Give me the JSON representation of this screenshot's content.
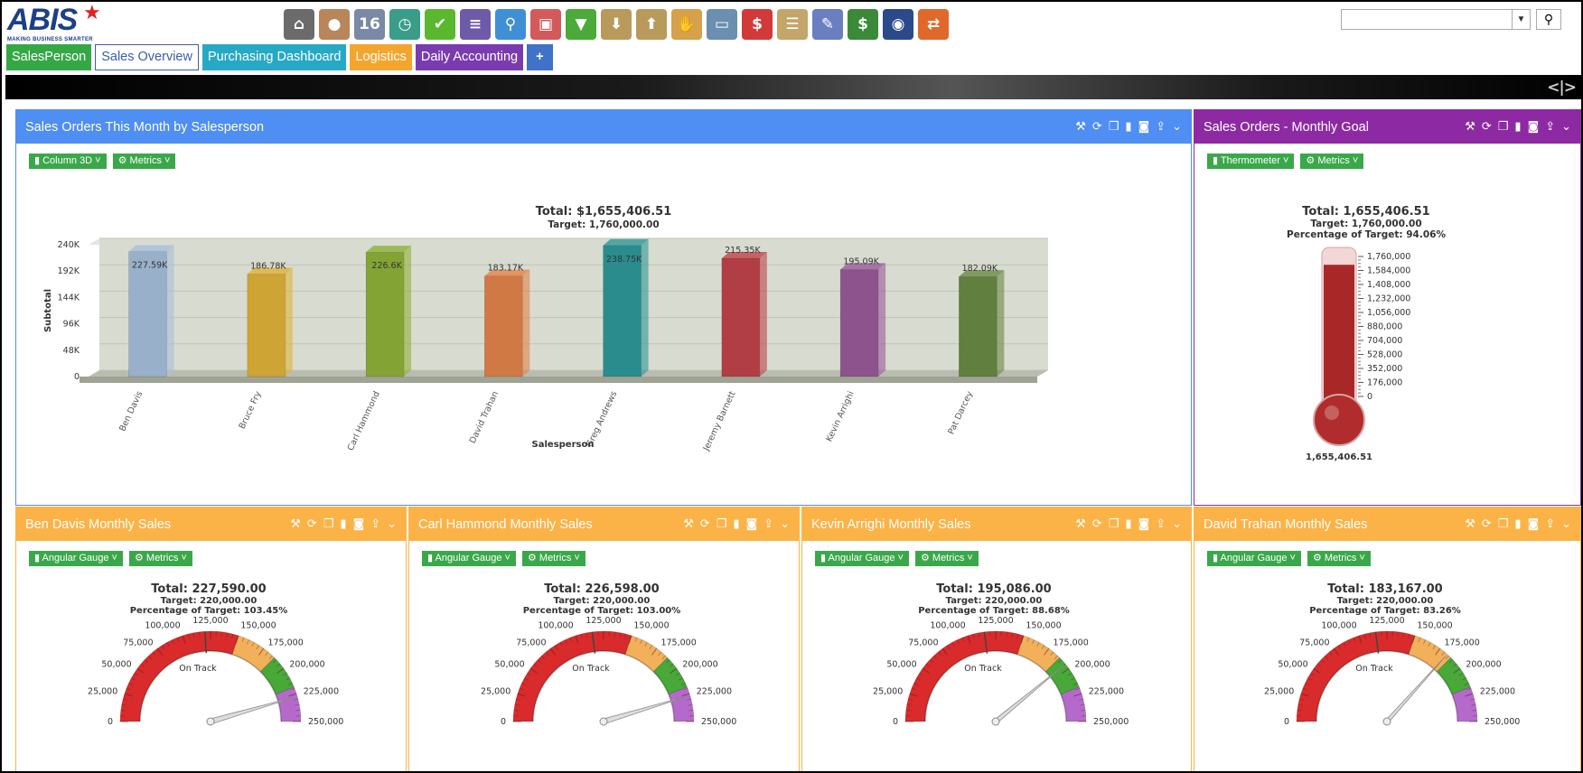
{
  "logo": {
    "text": "ABIS",
    "tagline": "MAKING BUSINESS SMARTER"
  },
  "toolbar": [
    {
      "icon": "bank-icon",
      "color": "#6b6b6b",
      "glyph": "⌂"
    },
    {
      "icon": "user-icon",
      "color": "#b8865a",
      "glyph": "●"
    },
    {
      "icon": "calendar-icon",
      "color": "#7a8aa6",
      "glyph": "16"
    },
    {
      "icon": "clock-icon",
      "color": "#3a9d8a",
      "glyph": "◷"
    },
    {
      "icon": "checkmark-icon",
      "color": "#5ab82f",
      "glyph": "✔"
    },
    {
      "icon": "register-icon",
      "color": "#6d5aa8",
      "glyph": "≡"
    },
    {
      "icon": "magnifier-icon",
      "color": "#3f8fd6",
      "glyph": "⚲"
    },
    {
      "icon": "truck-icon",
      "color": "#d25a5a",
      "glyph": "▣"
    },
    {
      "icon": "basket-icon",
      "color": "#4caa3a",
      "glyph": "▼"
    },
    {
      "icon": "inbox-download-icon",
      "color": "#b89a5a",
      "glyph": "⬇"
    },
    {
      "icon": "outbox-upload-icon",
      "color": "#b89a5a",
      "glyph": "⬆"
    },
    {
      "icon": "hand-coins-icon",
      "color": "#d7a04a",
      "glyph": "✋"
    },
    {
      "icon": "monitor-icon",
      "color": "#6a8fb0",
      "glyph": "▭"
    },
    {
      "icon": "dollar-bubble-icon",
      "color": "#d23a3a",
      "glyph": "$"
    },
    {
      "icon": "clipboard-icon",
      "color": "#c4a56a",
      "glyph": "☰"
    },
    {
      "icon": "pencil-ruler-icon",
      "color": "#6a7fc0",
      "glyph": "✎"
    },
    {
      "icon": "cash-icon",
      "color": "#3a8a3a",
      "glyph": "$"
    },
    {
      "icon": "globe-icon",
      "color": "#2a4a8a",
      "glyph": "◉"
    },
    {
      "icon": "sync-arrows-icon",
      "color": "#e0682a",
      "glyph": "⇄"
    }
  ],
  "search": {
    "placeholder": "",
    "value": ""
  },
  "tabs": [
    {
      "label": "SalesPerson",
      "color": "#35a846"
    },
    {
      "label": "Sales Overview",
      "color": "#ffffff"
    },
    {
      "label": "Purchasing Dashboard",
      "color": "#26a9c4"
    },
    {
      "label": "Logistics",
      "color": "#f4a52d"
    },
    {
      "label": "Daily Accounting",
      "color": "#7b3bb0"
    },
    {
      "label": "+",
      "color": "#3f72c8"
    }
  ],
  "panels": {
    "sales_orders": {
      "title": "Sales Orders This Month by Salesperson",
      "color": "#4f8ef2",
      "chart_type_label": "Column 3D",
      "metrics_label": "Metrics"
    },
    "monthly_goal": {
      "title": "Sales Orders - Monthly Goal",
      "color": "#8d2aa3",
      "chart_type_label": "Thermometer",
      "metrics_label": "Metrics"
    },
    "ben": {
      "title": "Ben Davis Monthly Sales",
      "color": "#fbb347",
      "chart_type_label": "Angular Gauge",
      "metrics_label": "Metrics"
    },
    "carl": {
      "title": "Carl Hammond Monthly Sales",
      "color": "#fbb347",
      "chart_type_label": "Angular Gauge",
      "metrics_label": "Metrics"
    },
    "kevin": {
      "title": "Kevin Arrighi Monthly Sales",
      "color": "#fbb347",
      "chart_type_label": "Angular Gauge",
      "metrics_label": "Metrics"
    },
    "david": {
      "title": "David Trahan Monthly Sales",
      "color": "#fbb347",
      "chart_type_label": "Angular Gauge",
      "metrics_label": "Metrics"
    }
  },
  "chart_data": [
    {
      "type": "bar",
      "title": "Total: $1,655,406.51",
      "subtitle": "Target: 1,760,000.00",
      "xlabel": "Salesperson",
      "ylabel": "Subtotal",
      "categories": [
        "Ben Davis",
        "Bruce Fry",
        "Carl Hammond",
        "David Trahan",
        "Greg Andrews",
        "Jeremy Barnett",
        "Kevin Arrighi",
        "Pat Darcey"
      ],
      "values": [
        227590,
        186780,
        226600,
        183170,
        238750,
        215350,
        195090,
        182090
      ],
      "value_labels": [
        "227.59K",
        "186.78K",
        "226.6K",
        "183.17K",
        "238.75K",
        "215.35K",
        "195.09K",
        "182.09K"
      ],
      "colors": [
        "#a7bfdc",
        "#e0b23a",
        "#8fb23a",
        "#e2844a",
        "#2e9898",
        "#c0444a",
        "#9a5b9a",
        "#6a8a45"
      ],
      "ylim": [
        0,
        240000
      ],
      "yticks": [
        "0",
        "48K",
        "96K",
        "144K",
        "192K",
        "240K"
      ],
      "grid": true,
      "legend": "none"
    },
    {
      "type": "thermometer",
      "title": "Total: 1,655,406.51",
      "subtitle": "Target: 1,760,000.00",
      "subtitle2": "Percentage of Target: 94.06%",
      "value": 1655406.51,
      "max": 1760000,
      "value_label": "1,655,406.51",
      "ticks": [
        "1,760,000",
        "1,584,000",
        "1,408,000",
        "1,232,000",
        "1,056,000",
        "880,000",
        "704,000",
        "528,000",
        "352,000",
        "176,000",
        "0"
      ]
    },
    {
      "type": "gauge",
      "name": "ben",
      "title": "Total: 227,590.00",
      "target": "Target: 220,000.00",
      "pct": "Percentage of Target: 103.45%",
      "value": 227590,
      "marker": 120000
    },
    {
      "type": "gauge",
      "name": "carl",
      "title": "Total: 226,598.00",
      "target": "Target: 220,000.00",
      "pct": "Percentage of Target: 103.00%",
      "value": 226598,
      "marker": 115000
    },
    {
      "type": "gauge",
      "name": "kevin",
      "title": "Total: 195,086.00",
      "target": "Target: 220,000.00",
      "pct": "Percentage of Target: 88.68%",
      "value": 195086,
      "marker": 115000
    },
    {
      "type": "gauge",
      "name": "david",
      "title": "Total: 183,167.00",
      "target": "Target: 220,000.00",
      "pct": "Percentage of Target: 83.26%",
      "value": 183167,
      "marker": 115000
    }
  ],
  "gauge_common": {
    "max": 250000,
    "band_label": "On Track",
    "tick_labels": [
      "0",
      "25,000",
      "50,000",
      "75,000",
      "100,000",
      "125,000",
      "150,000",
      "175,000",
      "200,000",
      "225,000",
      "250,000"
    ],
    "bands": [
      {
        "from": 0,
        "to": 150000,
        "color": "#d92b2b"
      },
      {
        "from": 150000,
        "to": 187500,
        "color": "#f3b05a"
      },
      {
        "from": 187500,
        "to": 218750,
        "color": "#48a838"
      },
      {
        "from": 218750,
        "to": 250000,
        "color": "#b56acb"
      }
    ]
  }
}
